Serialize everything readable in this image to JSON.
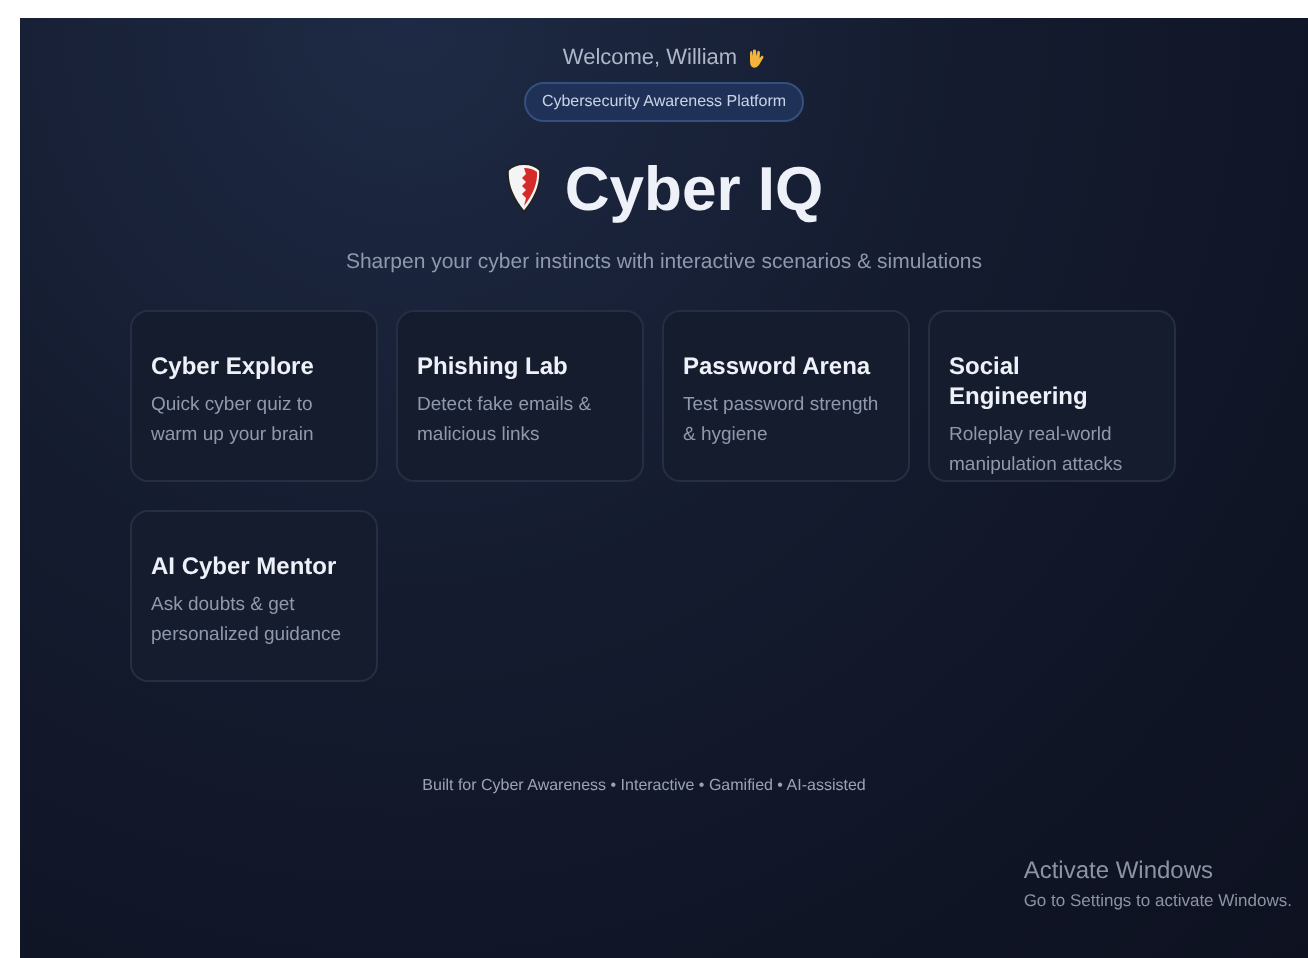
{
  "welcome": "Welcome, William",
  "badge": "Cybersecurity Awareness Platform",
  "title": "Cyber IQ",
  "subtitle": "Sharpen your cyber instincts with interactive scenarios & simulations",
  "cards": [
    {
      "title": "Cyber Explore",
      "description": "Quick cyber quiz to warm up your brain"
    },
    {
      "title": "Phishing Lab",
      "description": "Detect fake emails & malicious links"
    },
    {
      "title": "Password Arena",
      "description": "Test password strength & hygiene"
    },
    {
      "title": "Social Engineering",
      "description": "Roleplay real-world manipulation attacks"
    },
    {
      "title": "AI Cyber Mentor",
      "description": "Ask doubts & get personalized guidance"
    }
  ],
  "footer": "Built for Cyber Awareness • Interactive • Gamified • AI-assisted",
  "activation_notice": {
    "title": "Activate Windows",
    "message": "Go to Settings to activate Windows."
  }
}
